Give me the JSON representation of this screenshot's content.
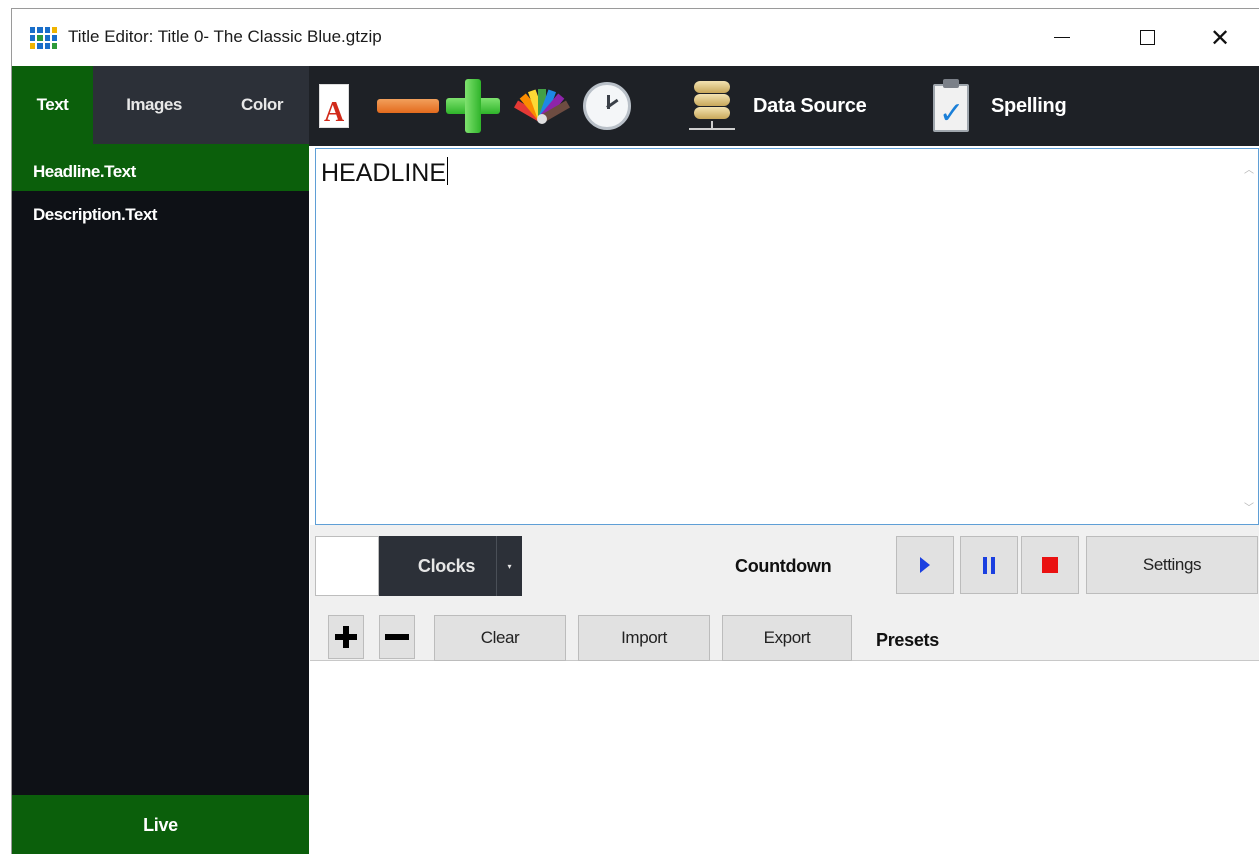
{
  "window": {
    "title": "Title Editor: Title 0- The Classic Blue.gtzip",
    "close_glyph": "✕"
  },
  "tabs": [
    {
      "label": "Text",
      "selected": true
    },
    {
      "label": "Images",
      "selected": false
    },
    {
      "label": "Color",
      "selected": false
    }
  ],
  "toolbar": {
    "font_icon_letter": "A",
    "data_source_label": "Data Source",
    "spelling_label": "Spelling",
    "icons": [
      "font-icon",
      "minus-icon",
      "plus-icon",
      "palette-icon",
      "clock-icon",
      "database-icon",
      "spell-check-icon"
    ]
  },
  "fields": [
    {
      "label": "Headline.Text",
      "selected": true
    },
    {
      "label": "Description.Text",
      "selected": false
    }
  ],
  "live_label": "Live",
  "editor": {
    "value": "HEADLINE",
    "scroll_up_glyph": "︿",
    "scroll_down_glyph": "﹀"
  },
  "clock_panel": {
    "clocks_label": "Clocks",
    "dropdown_glyph": "▾",
    "countdown_label": "Countdown",
    "settings_label": "Settings"
  },
  "presets_panel": {
    "clear_label": "Clear",
    "import_label": "Import",
    "export_label": "Export",
    "presets_label": "Presets"
  },
  "colors": {
    "accent_green": "#0b5f0b",
    "dark_panel": "#1e2126",
    "sidebar_bg": "#0e1116",
    "play_blue": "#1a3fe0",
    "stop_red": "#ea1111"
  }
}
